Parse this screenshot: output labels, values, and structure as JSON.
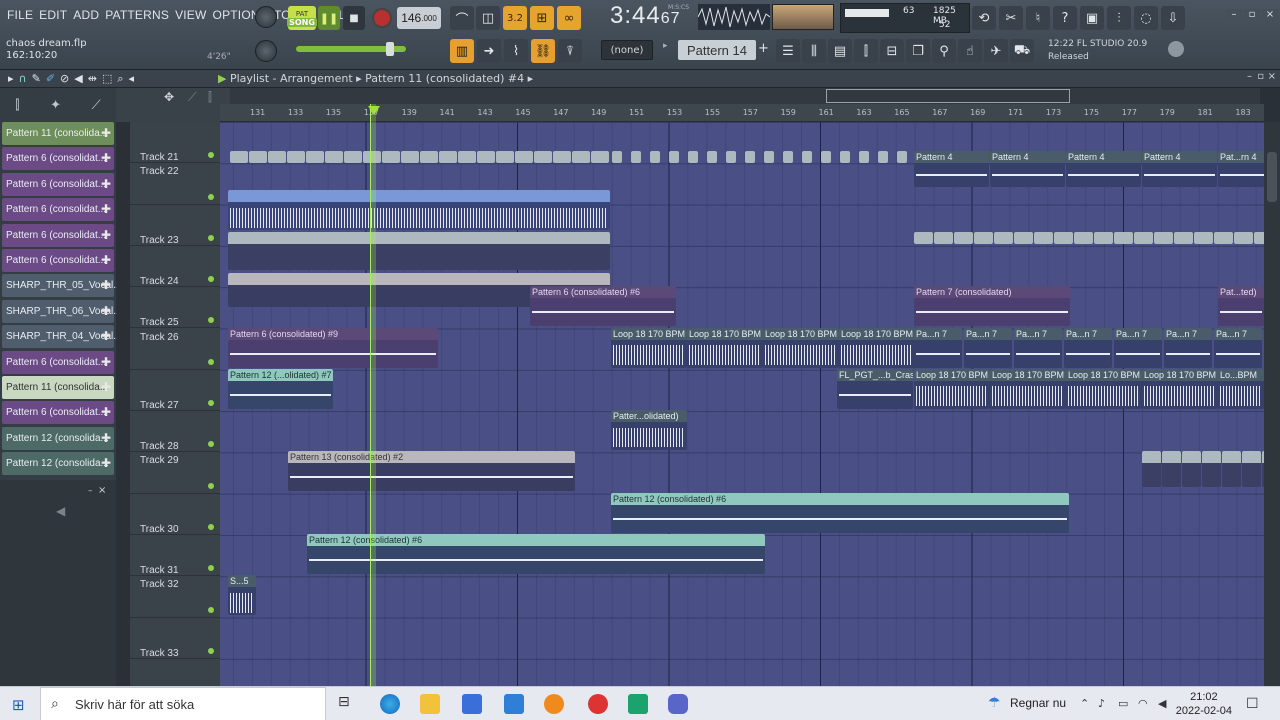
{
  "menu": [
    "FILE",
    "EDIT",
    "ADD",
    "PATTERNS",
    "VIEW",
    "OPTIONS",
    "TOOLS",
    "HELP"
  ],
  "project": {
    "name": "chaos dream.flp",
    "position": "162:10:20",
    "length": "4'26\""
  },
  "transport": {
    "mode_pat": "PAT",
    "mode_song": "SONG",
    "tempo": "146",
    "tempo_dec": ".000",
    "time": "3:44",
    "time_sub": "67",
    "time_label": "M:S:CS"
  },
  "monitor": {
    "cpu": "63",
    "memory": "1825 MB",
    "voices": "52"
  },
  "pattern": {
    "snap": "(none)",
    "current": "Pattern 14"
  },
  "hint": {
    "line1": "12:22  FL STUDIO 20.9",
    "line2": "Released"
  },
  "playlist": {
    "title": "Playlist - Arrangement",
    "breadcrumb": "Pattern 11 (consolidated) #4"
  },
  "picker": [
    {
      "label": "Pattern 11 (consolida...",
      "color": "#6e8f5b"
    },
    {
      "label": "Pattern 6 (consolidat...",
      "color": "#6b4a86"
    },
    {
      "label": "Pattern 6 (consolidat...",
      "color": "#6b4a86"
    },
    {
      "label": "Pattern 6 (consolidat...",
      "color": "#6b4a86"
    },
    {
      "label": "Pattern 6 (consolidat...",
      "color": "#6b4a86"
    },
    {
      "label": "Pattern 6 (consolidat...",
      "color": "#6b4a86"
    },
    {
      "label": "SHARP_THR_05_Vocal...",
      "color": "#4f5d6c"
    },
    {
      "label": "SHARP_THR_06_Vocal...",
      "color": "#4f5d6c"
    },
    {
      "label": "SHARP_THR_04_Vocal...",
      "color": "#4f5d6c"
    },
    {
      "label": "Pattern 6 (consolidat...",
      "color": "#6b4a86"
    },
    {
      "label": "Pattern 11 (consolida...",
      "color": "#c9d8c0"
    },
    {
      "label": "Pattern 6 (consolidat...",
      "color": "#6b4a86"
    },
    {
      "label": "Pattern 12 (consolida...",
      "color": "#4d6a66"
    },
    {
      "label": "Pattern 12 (consolida...",
      "color": "#4d6a66"
    }
  ],
  "tracks": [
    "Track 21",
    "Track 22",
    "Track 23",
    "Track 24",
    "Track 25",
    "Track 26",
    "Track 27",
    "Track 28",
    "Track 29",
    "Track 30",
    "Track 31",
    "Track 32",
    "Track 33"
  ],
  "ruler": [
    "131",
    "133",
    "135",
    "137",
    "139",
    "141",
    "143",
    "145",
    "147",
    "149",
    "151",
    "153",
    "155",
    "157",
    "159",
    "161",
    "163",
    "165",
    "167",
    "169",
    "171",
    "173",
    "175",
    "177",
    "179",
    "181",
    "183"
  ],
  "clips": {
    "p4": "Pattern 4",
    "p4b": "Pat...rn 4",
    "p6_6": "Pattern 6 (consolidated) #6",
    "p7": "Pattern 7 (consolidated)",
    "pted": "Pat...ted)",
    "p6_9": "Pattern 6 (consolidated) #9",
    "loop": "Loop 18 170 BPM",
    "pan7": "Pa...n 7",
    "p12_7": "Pattern 12 (...olidated) #7",
    "crash": "FL_PGT_...b_Crash",
    "lobpm": "Lo...BPM",
    "patter": "Patter...olidated)",
    "p13_2": "Pattern 13 (consolidated) #2",
    "p12_6": "Pattern 12 (consolidated) #6",
    "s5": "S...5"
  },
  "taskbar": {
    "search": "Skriv här för att söka",
    "weather": "Regnar nu",
    "time": "21:02",
    "date": "2022-02-04"
  }
}
